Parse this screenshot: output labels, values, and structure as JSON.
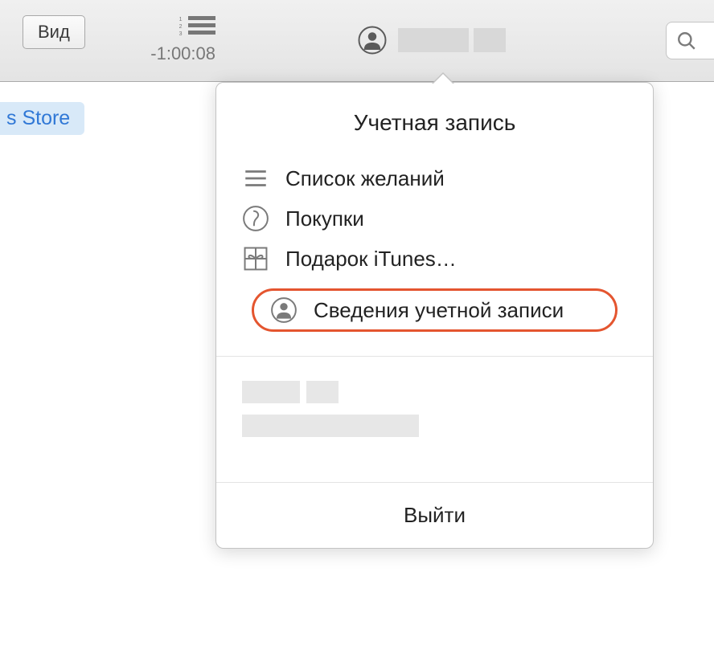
{
  "toolbar": {
    "view_button_label": "Вид",
    "time_display": "-1:00:08",
    "store_tab_label": "s Store"
  },
  "popover": {
    "title": "Учетная запись",
    "items": {
      "wishlist": "Список желаний",
      "purchases": "Покупки",
      "gift": "Подарок iTunes…",
      "account_info": "Сведения учетной записи"
    },
    "signout_label": "Выйти"
  }
}
